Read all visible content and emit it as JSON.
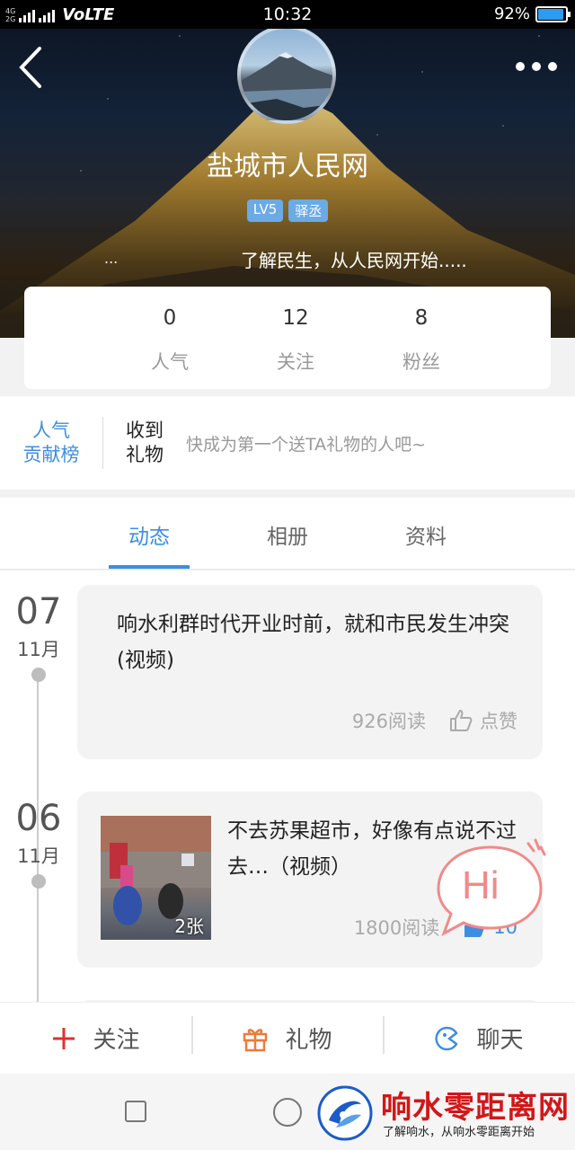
{
  "status_bar": {
    "network_top": "4G",
    "network_bottom": "2G",
    "volte": "VoLTE",
    "time": "10:32",
    "battery_percent": "92%",
    "battery_level": 0.92
  },
  "profile": {
    "name": "盐城市人民网",
    "badges": [
      "LV5",
      "驿丞"
    ],
    "signature": "了解民生，从人民网开始.....",
    "signature_prefix": "..."
  },
  "stats": [
    {
      "value": "0",
      "label": "人气"
    },
    {
      "value": "12",
      "label": "关注"
    },
    {
      "value": "8",
      "label": "粉丝"
    }
  ],
  "gifts": {
    "rank_line1": "人气",
    "rank_line2": "贡献榜",
    "received_line1": "收到",
    "received_line2": "礼物",
    "hint": "快成为第一个送TA礼物的人吧~"
  },
  "tabs": [
    {
      "label": "动态",
      "active": true
    },
    {
      "label": "相册",
      "active": false
    },
    {
      "label": "资料",
      "active": false
    }
  ],
  "posts": [
    {
      "day": "07",
      "month": "11月",
      "text": "响水利群时代开业时前，就和市民发生冲突(视频)",
      "reads": "926阅读",
      "like_label": "点赞"
    },
    {
      "day": "06",
      "month": "11月",
      "text": "不去苏果超市，好像有点说不过去…（视频）",
      "reads": "1800阅读",
      "like_label": "10",
      "image_count": "2张"
    }
  ],
  "hi_bubble": "Hi",
  "actions": [
    {
      "label": "关注",
      "icon": "plus-icon"
    },
    {
      "label": "礼物",
      "icon": "gift-icon"
    },
    {
      "label": "聊天",
      "icon": "chat-icon"
    }
  ],
  "watermark": {
    "title": "响水零距离网",
    "subtitle": "了解响水，从响水零距离开始"
  },
  "colors": {
    "accent": "#3d8ee0",
    "badge": "#6aaae6",
    "hi_red": "#f08a8a",
    "gift_orange": "#f07a3a",
    "follow_red": "#e03030"
  }
}
